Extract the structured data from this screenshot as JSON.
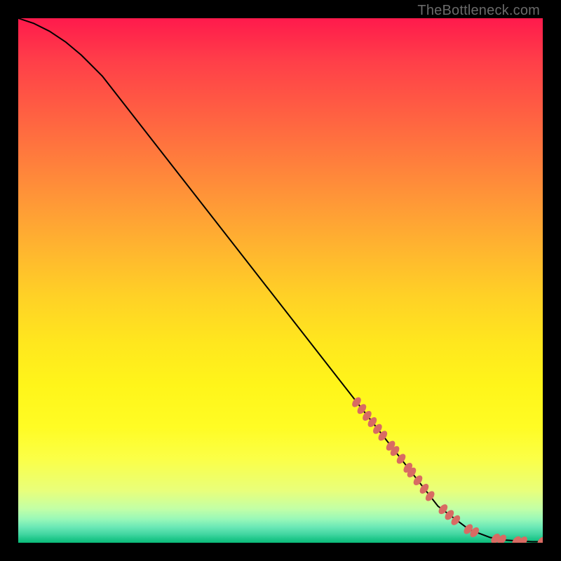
{
  "watermark_text": "TheBottleneck.com",
  "colors": {
    "background": "#000000",
    "curve_stroke": "#000000",
    "marker_fill": "#d86b63",
    "marker_stroke": "#d86b63"
  },
  "chart_data": {
    "type": "line",
    "title": "",
    "xlabel": "",
    "ylabel": "",
    "xlim": [
      0,
      100
    ],
    "ylim": [
      0,
      100
    ],
    "grid": false,
    "series": [
      {
        "name": "curve",
        "x": [
          0,
          3,
          6,
          9,
          12,
          16,
          80,
          86,
          90,
          93,
          96,
          98,
          100
        ],
        "y": [
          100,
          99,
          97.5,
          95.5,
          93,
          89,
          7,
          2.5,
          1,
          0.5,
          0.3,
          0.2,
          0.2
        ]
      }
    ],
    "markers": {
      "name": "highlight-points",
      "points": [
        {
          "x": 64.5,
          "y": 26.8
        },
        {
          "x": 65.5,
          "y": 25.5
        },
        {
          "x": 66.5,
          "y": 24.2
        },
        {
          "x": 67.5,
          "y": 23.0
        },
        {
          "x": 68.5,
          "y": 21.7
        },
        {
          "x": 69.5,
          "y": 20.4
        },
        {
          "x": 71.0,
          "y": 18.5
        },
        {
          "x": 71.8,
          "y": 17.5
        },
        {
          "x": 73.0,
          "y": 16.0
        },
        {
          "x": 74.3,
          "y": 14.3
        },
        {
          "x": 75.0,
          "y": 13.4
        },
        {
          "x": 76.2,
          "y": 11.9
        },
        {
          "x": 77.4,
          "y": 10.3
        },
        {
          "x": 78.5,
          "y": 8.9
        },
        {
          "x": 81.0,
          "y": 6.4
        },
        {
          "x": 82.2,
          "y": 5.3
        },
        {
          "x": 83.4,
          "y": 4.3
        },
        {
          "x": 85.8,
          "y": 2.6
        },
        {
          "x": 87.0,
          "y": 2.0
        },
        {
          "x": 91.0,
          "y": 0.8
        },
        {
          "x": 92.2,
          "y": 0.6
        },
        {
          "x": 95.0,
          "y": 0.3
        },
        {
          "x": 96.2,
          "y": 0.25
        },
        {
          "x": 99.8,
          "y": 0.2
        }
      ]
    }
  }
}
